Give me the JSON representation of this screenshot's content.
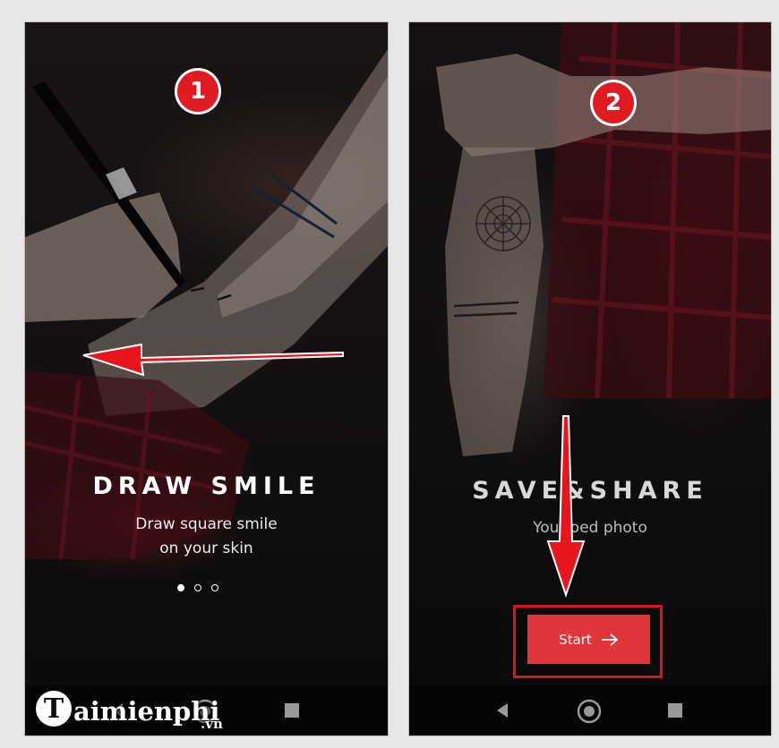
{
  "left_screen": {
    "step": "1",
    "title": "DRAW SMILE",
    "subtitle_line1": "Draw square smile",
    "subtitle_line2": "on your skin",
    "pager": {
      "total": 3,
      "active": 1
    }
  },
  "right_screen": {
    "step": "2",
    "title": "SAVE&SHARE",
    "subtitle": "Your       oed photo",
    "start_button_label": "Start",
    "start_button_icon": "arrow-right-icon"
  },
  "nav_bar": {
    "icons": [
      "back-icon",
      "home-icon",
      "recents-icon"
    ]
  },
  "watermark": {
    "logo_letter": "T",
    "text": "aimienphi",
    "domain": ".vn"
  },
  "colors": {
    "badge": "#e01b22",
    "annotation_arrow": "#e8151c",
    "start_button": "#e0353b",
    "highlight": "#d8131b"
  }
}
